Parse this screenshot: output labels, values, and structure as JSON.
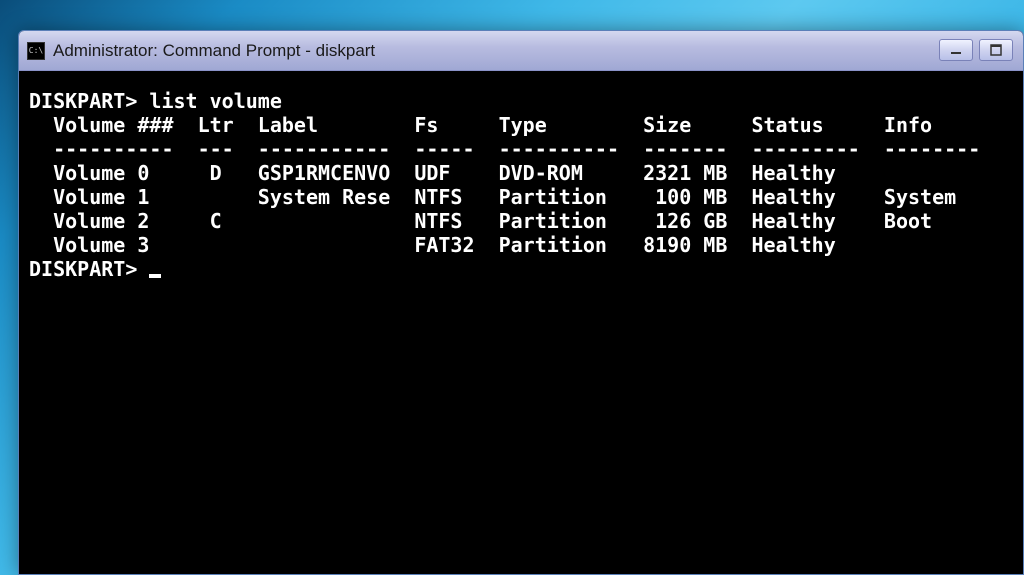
{
  "window": {
    "title": "Administrator: Command Prompt - diskpart",
    "icon_label": "C:\\"
  },
  "terminal": {
    "prompt1": "DISKPART> list volume",
    "blank": "",
    "header": "  Volume ###  Ltr  Label        Fs     Type        Size     Status     Info",
    "divider": "  ----------  ---  -----------  -----  ----------  -------  ---------  --------",
    "rows": [
      "  Volume 0     D   GSP1RMCENVO  UDF    DVD-ROM     2321 MB  Healthy",
      "  Volume 1         System Rese  NTFS   Partition    100 MB  Healthy    System",
      "  Volume 2     C                NTFS   Partition    126 GB  Healthy    Boot",
      "  Volume 3                      FAT32  Partition   8190 MB  Healthy"
    ],
    "prompt2": "DISKPART> "
  },
  "volumes_structured": [
    {
      "num": 0,
      "ltr": "D",
      "label": "GSP1RMCENVO",
      "fs": "UDF",
      "type": "DVD-ROM",
      "size": "2321 MB",
      "status": "Healthy",
      "info": ""
    },
    {
      "num": 1,
      "ltr": "",
      "label": "System Rese",
      "fs": "NTFS",
      "type": "Partition",
      "size": "100 MB",
      "status": "Healthy",
      "info": "System"
    },
    {
      "num": 2,
      "ltr": "C",
      "label": "",
      "fs": "NTFS",
      "type": "Partition",
      "size": "126 GB",
      "status": "Healthy",
      "info": "Boot"
    },
    {
      "num": 3,
      "ltr": "",
      "label": "",
      "fs": "FAT32",
      "type": "Partition",
      "size": "8190 MB",
      "status": "Healthy",
      "info": ""
    }
  ]
}
